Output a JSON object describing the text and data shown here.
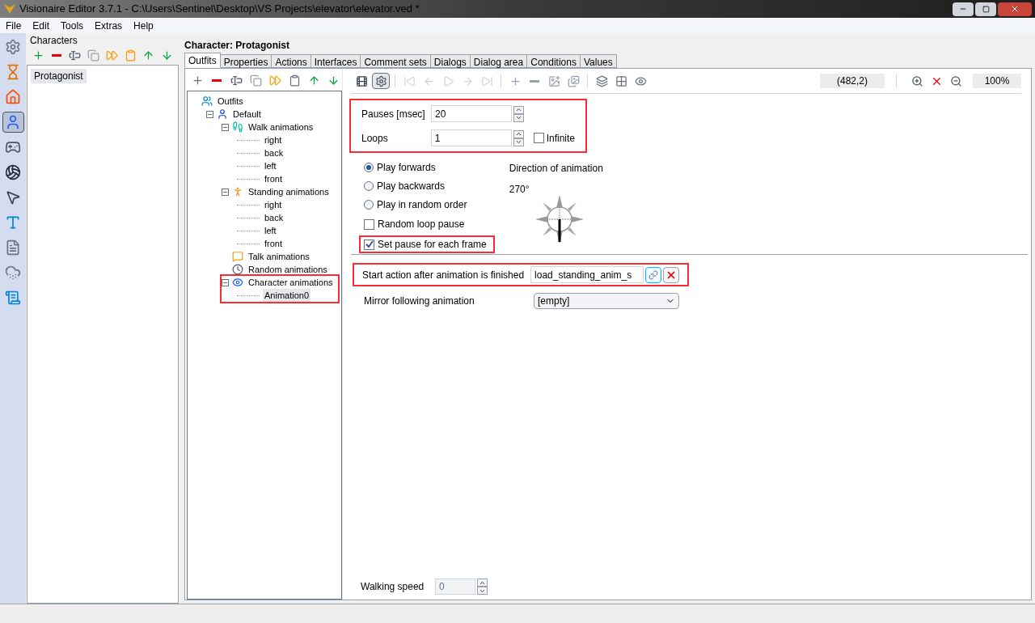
{
  "window": {
    "title": "Visionaire Editor 3.7.1 - C:\\Users\\Sentinel\\Desktop\\VS Projects\\elevator\\elevator.ved *"
  },
  "menu": [
    "File",
    "Edit",
    "Tools",
    "Extras",
    "Help"
  ],
  "sidebar": [
    {
      "kind": "gear",
      "selected": false
    },
    {
      "kind": "hourglass",
      "selected": false
    },
    {
      "kind": "house",
      "selected": false
    },
    {
      "kind": "person",
      "selected": true
    },
    {
      "kind": "gamepad",
      "selected": false
    },
    {
      "kind": "ball",
      "selected": false
    },
    {
      "kind": "cursor",
      "selected": false
    },
    {
      "kind": "font",
      "selected": false
    },
    {
      "kind": "document",
      "selected": false
    },
    {
      "kind": "cloud",
      "selected": false
    },
    {
      "kind": "script",
      "selected": false
    }
  ],
  "characters": {
    "title": "Characters",
    "items": [
      {
        "label": "Protagonist",
        "selected": true
      }
    ]
  },
  "header": "Character: Protagonist",
  "tabs": [
    {
      "label": "Outfits",
      "selected": true
    },
    {
      "label": "Properties",
      "selected": false
    },
    {
      "label": "Actions",
      "selected": false
    },
    {
      "label": "Interfaces",
      "selected": false
    },
    {
      "label": "Comment sets",
      "selected": false
    },
    {
      "label": "Dialogs",
      "selected": false
    },
    {
      "label": "Dialog area",
      "selected": false
    },
    {
      "label": "Conditions",
      "selected": false
    },
    {
      "label": "Values",
      "selected": false
    }
  ],
  "tree": [
    {
      "label": "Outfits",
      "kind": "group",
      "children": [
        {
          "label": "Default",
          "kind": "person",
          "expanded": true,
          "children": [
            {
              "label": "Walk animations",
              "kind": "walk",
              "expanded": true,
              "children": [
                {
                  "label": "right",
                  "selected": false
                },
                {
                  "label": "back",
                  "selected": false
                },
                {
                  "label": "left",
                  "selected": false
                },
                {
                  "label": "front",
                  "selected": false
                }
              ]
            },
            {
              "label": "Standing animations",
              "kind": "stand",
              "expanded": true,
              "children": [
                {
                  "label": "right",
                  "selected": false
                },
                {
                  "label": "back",
                  "selected": false
                },
                {
                  "label": "left",
                  "selected": false
                },
                {
                  "label": "front",
                  "selected": false
                }
              ]
            },
            {
              "label": "Talk animations",
              "kind": "talk"
            },
            {
              "label": "Random animations",
              "kind": "clock"
            },
            {
              "label": "Character animations",
              "kind": "eye",
              "expanded": true,
              "highlighted": true,
              "children": [
                {
                  "label": "Animation0",
                  "selected": true
                }
              ]
            }
          ]
        }
      ]
    }
  ],
  "toolbar": {
    "frames_pressed": true,
    "position": "(482,2)",
    "zoom": "100%"
  },
  "timing": {
    "highlighted": true,
    "pauses_label": "Pauses [msec]",
    "pauses": "20",
    "loops_label": "Loops",
    "loops": "1",
    "infinite": {
      "label": "Infinite",
      "checked": false
    }
  },
  "play_modes": [
    {
      "label": "Play forwards",
      "selected": true
    },
    {
      "label": "Play backwards",
      "selected": false
    },
    {
      "label": "Play in random order",
      "selected": false
    }
  ],
  "options": [
    {
      "label": "Random loop pause",
      "checked": false,
      "highlighted": false
    },
    {
      "label": "Set pause for each frame",
      "checked": true,
      "highlighted": true
    }
  ],
  "direction": {
    "label": "Direction of animation",
    "angle": "270°"
  },
  "start_action": {
    "highlighted": true,
    "label": "Start action after animation is finished",
    "value": "load_standing_anim_s"
  },
  "mirror": {
    "label": "Mirror following animation",
    "value": "[empty]"
  },
  "walking_speed": {
    "label": "Walking speed",
    "value": "0",
    "disabled": true
  }
}
